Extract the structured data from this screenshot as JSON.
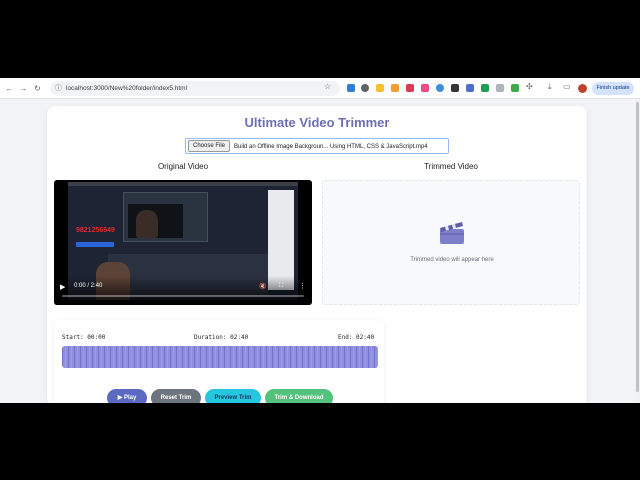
{
  "browser": {
    "url": "localhost:3000/New%20folder/index5.html",
    "finish_update_label": "Finish update"
  },
  "page": {
    "title": "Ultimate Video Trimmer",
    "file_picker": {
      "button_label": "Choose File",
      "file_name": "Build an Offline Image Backgroun... Using HTML, CSS & JavaScript.mp4"
    },
    "original_label": "Original Video",
    "trimmed_label": "Trimmed Video",
    "trimmed_placeholder": "Trimmed video will appear here",
    "video": {
      "overlay_number": "9821256649",
      "current_time": "0:00 / 2:40",
      "progress": 0
    },
    "trim": {
      "start_label": "Start: 00:00",
      "duration_label": "Duration: 02:40",
      "end_label": "End: 02:40"
    },
    "buttons": {
      "play": "▶ Play",
      "reset": "Reset Trim",
      "preview": "Preview Trim",
      "download": "Trim & Download"
    }
  },
  "colors": {
    "title": "#6d6fb3",
    "waveform": "#8f8ee0",
    "play_button": "#5b6abf",
    "reset_button": "#6c757d",
    "preview_button": "#25c6e0",
    "download_button": "#52c27c"
  }
}
